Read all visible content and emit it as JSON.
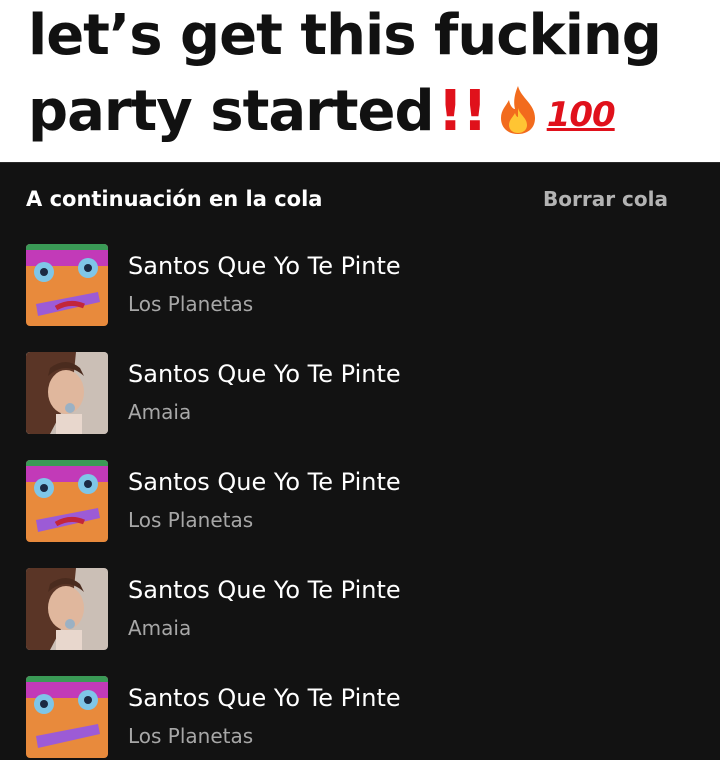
{
  "caption": {
    "line1": "let’s get this fucking",
    "line2": "party started",
    "emphasis": "!!",
    "emoji_100": "100"
  },
  "queue": {
    "header": "A continuación en la cola",
    "clear_label": "Borrar cola",
    "tracks": [
      {
        "title": "Santos Que Yo Te Pinte",
        "artist": "Los Planetas",
        "art": "los-planetas-cover"
      },
      {
        "title": "Santos Que Yo Te Pinte",
        "artist": "Amaia",
        "art": "amaia-cover"
      },
      {
        "title": "Santos Que Yo Te Pinte",
        "artist": "Los Planetas",
        "art": "los-planetas-cover"
      },
      {
        "title": "Santos Que Yo Te Pinte",
        "artist": "Amaia",
        "art": "amaia-cover"
      },
      {
        "title": "Santos Que Yo Te Pinte",
        "artist": "Los Planetas",
        "art": "los-planetas-cover"
      }
    ]
  },
  "colors": {
    "background": "#121212",
    "text_primary": "#ffffff",
    "text_secondary": "#a7a7a7",
    "caption_bg": "#ffffff",
    "emphasis": "#e0111b"
  }
}
